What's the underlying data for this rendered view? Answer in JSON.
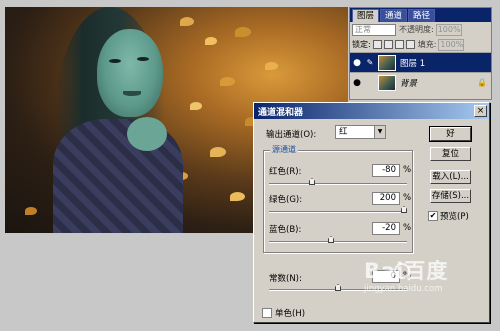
{
  "layers_panel": {
    "tabs": [
      "图层",
      "通道",
      "路径"
    ],
    "blend_mode": "正常",
    "opacity_label": "不透明度:",
    "opacity_value": "100%",
    "lock_label": "锁定:",
    "fill_label": "填充:",
    "fill_value": "100%",
    "layers": [
      {
        "name": "图层 1",
        "selected": true
      },
      {
        "name": "背景",
        "selected": false
      }
    ]
  },
  "dialog": {
    "title": "通道混和器",
    "close_glyph": "×",
    "output_channel_label": "输出通道(O):",
    "output_channel_value": "红",
    "source_group_title": "源通道",
    "channels": [
      {
        "label": "红色(R):",
        "value": "-80",
        "unit": "%",
        "slider_pct": 0.3
      },
      {
        "label": "绿色(G):",
        "value": "200",
        "unit": "%",
        "slider_pct": 1.0
      },
      {
        "label": "蓝色(B):",
        "value": "-20",
        "unit": "%",
        "slider_pct": 0.45
      }
    ],
    "constant_label": "常数(N):",
    "constant_value": "0",
    "constant_unit": "%",
    "buttons": {
      "ok": "好",
      "reset": "复位",
      "load": "载入(L)...",
      "save": "存储(S)..."
    },
    "preview_label": "预览(P)",
    "preview_checked": true,
    "monochrome_label": "单色(H)",
    "monochrome_checked": false
  },
  "watermark": {
    "mark": "Bai百度",
    "url": "jingyan.baidu.com"
  },
  "colors": {
    "titlebar": "#0a246a",
    "dialog_bg": "#d4d0c8"
  }
}
